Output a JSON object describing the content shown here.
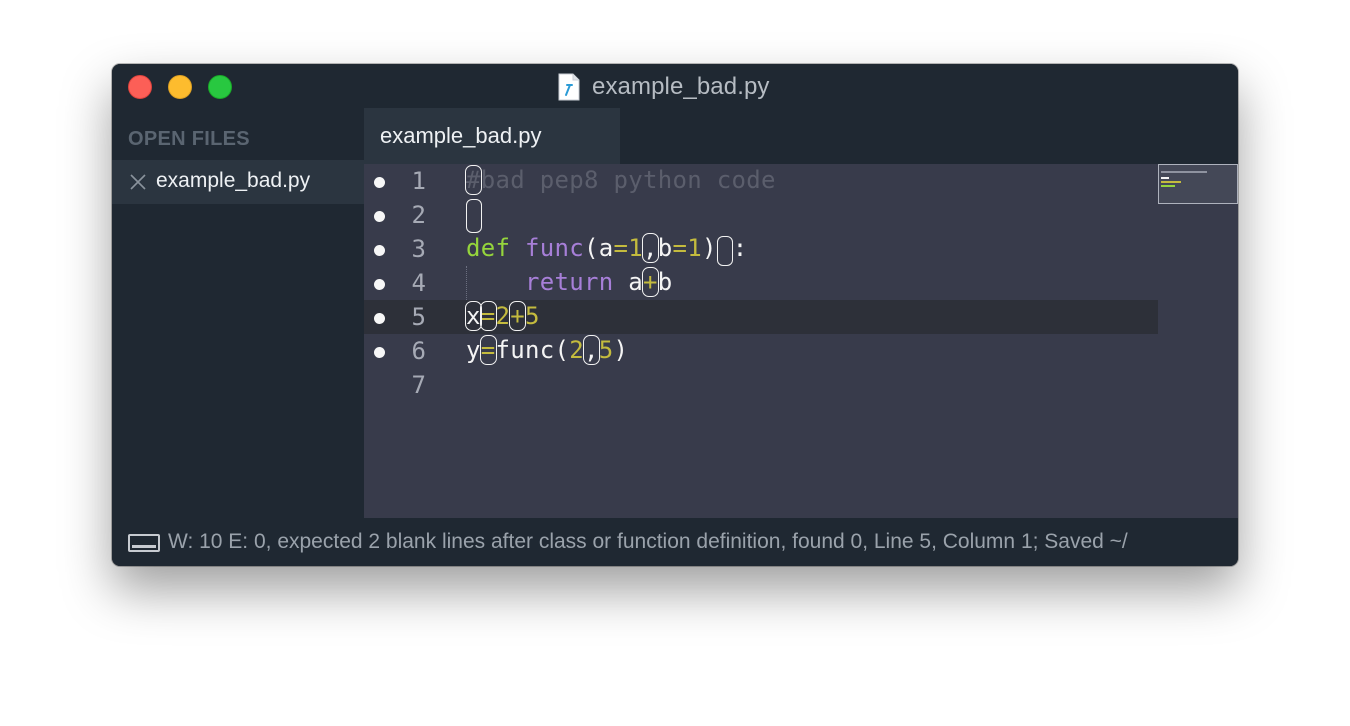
{
  "window": {
    "title": "example_bad.py"
  },
  "sidebar": {
    "header": "OPEN FILES",
    "files": [
      {
        "name": "example_bad.py",
        "icon": "close-icon"
      }
    ]
  },
  "tabs": [
    {
      "label": "example_bad.py",
      "active": true
    }
  ],
  "editor": {
    "current_line": 5,
    "lines": [
      {
        "number": "1",
        "text": "#bad pep8 python code",
        "has_error_marker": true
      },
      {
        "number": "2",
        "text": "",
        "has_error_marker": true
      },
      {
        "number": "3",
        "text": "def func(a=1,b=1):",
        "has_error_marker": true
      },
      {
        "number": "4",
        "text": "    return a+b",
        "has_error_marker": true
      },
      {
        "number": "5",
        "text": "x=2+5",
        "has_error_marker": true
      },
      {
        "number": "6",
        "text": "y=func(2,5)",
        "has_error_marker": true
      },
      {
        "number": "7",
        "text": "",
        "has_error_marker": false
      }
    ]
  },
  "status": {
    "text": "W: 10 E: 0, expected 2 blank lines after class or function definition, found 0, Line 5, Column 1; Saved ~/"
  },
  "colors": {
    "window_bg": "#1f2832",
    "editor_bg": "#383b4b",
    "keyword": "#95d53c",
    "function": "#a77fd8",
    "operator": "#c4bb3e",
    "comment": "#5b5e6c"
  }
}
